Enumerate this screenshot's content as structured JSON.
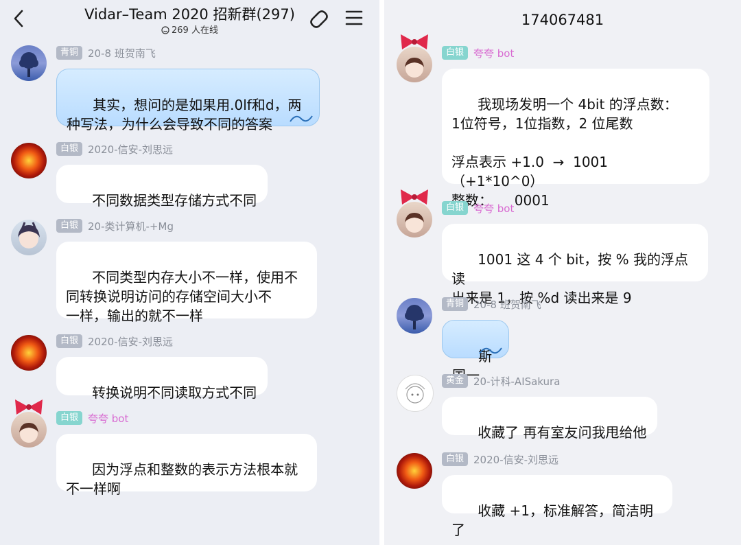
{
  "header": {
    "title": "Vidar–Team 2020 招新群(297)",
    "online": "269 人在线"
  },
  "right_header": {
    "title": "174067481"
  },
  "left_messages": [
    {
      "badge": "青铜",
      "name": "20-8 班贺南飞",
      "text": "其实，想问的是如果用.0lf和d，两\n种写法，为什么会导致不同的答案",
      "avatar": "tree-avatar"
    },
    {
      "badge": "白银",
      "name": "2020-信安-刘思远",
      "text": "不同数据类型存储方式不同",
      "avatar": "flower-avatar"
    },
    {
      "badge": "白银",
      "name": "20-类计算机-+Mg",
      "text": "不同类型内存大小不一样，使用不\n同转换说明访问的存储空间大小不\n一样，输出的就不一样",
      "avatar": "anime-avatar"
    },
    {
      "badge": "白银",
      "name": "2020-信安-刘思远",
      "text": "转换说明不同读取方式不同",
      "avatar": "flower-avatar"
    },
    {
      "badge": "白银",
      "name": "夸夸 bot",
      "text": "因为浮点和整数的表示方法根本就\n不一样啊",
      "avatar": "bow-avatar"
    }
  ],
  "right_messages": [
    {
      "badge": "白银",
      "name": "夸夸 bot",
      "text": "我现场发明一个 4bit 的浮点数：\n1位符号，1位指数，2 位尾数\n\n浮点表示 +1.0  →  1001（+1*10^0）\n整数：     0001",
      "avatar": "bow-avatar"
    },
    {
      "badge": "白银",
      "name": "夸夸 bot",
      "text": "1001 这 4 个 bit，按 % 我的浮点    读\n出来是 1，按 %d 读出来是 9",
      "avatar": "bow-avatar"
    },
    {
      "badge": "青铜",
      "name": "20-8 班贺南飞",
      "text": "斯国一",
      "avatar": "tree-avatar"
    },
    {
      "badge": "黄金",
      "name": "20-计科-AISakura",
      "text": "收藏了 再有室友问我甩给他",
      "avatar": "sketch-avatar"
    },
    {
      "badge": "白银",
      "name": "2020-信安-刘思远",
      "text": "收藏 +1，标准解答，简洁明了",
      "avatar": "flower-avatar"
    }
  ]
}
